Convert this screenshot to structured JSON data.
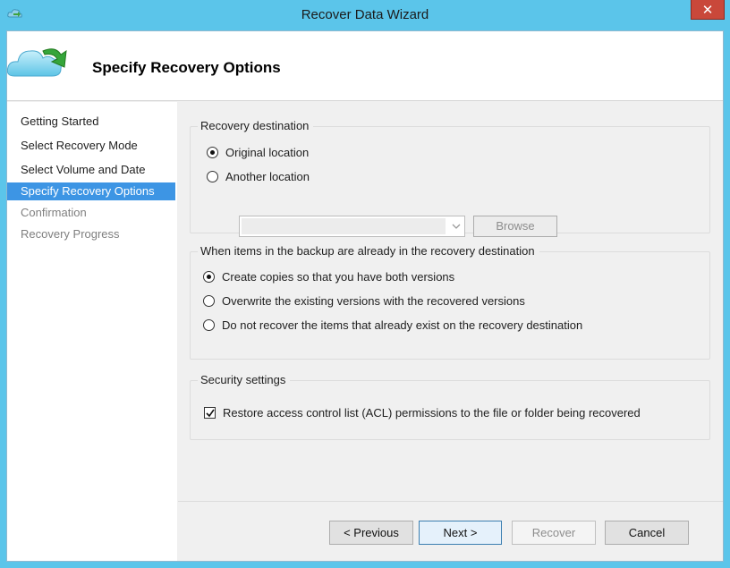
{
  "window": {
    "title": "Recover Data Wizard"
  },
  "header": {
    "title": "Specify Recovery Options"
  },
  "nav": {
    "items": [
      {
        "label": "Getting Started",
        "state": "done"
      },
      {
        "label": "Select Recovery Mode",
        "state": "done"
      },
      {
        "label": "Select Volume and Date",
        "state": "done"
      },
      {
        "label": "Specify Recovery Options",
        "state": "active"
      },
      {
        "label": "Confirmation",
        "state": "future"
      },
      {
        "label": "Recovery Progress",
        "state": "future"
      }
    ]
  },
  "recovery_destination": {
    "label": "Recovery destination",
    "options": [
      {
        "label": "Original location",
        "selected": true
      },
      {
        "label": "Another location",
        "selected": false
      }
    ],
    "location_value": "",
    "browse_label": "Browse"
  },
  "conflict": {
    "label": "When items in the backup are already in the recovery destination",
    "options": [
      {
        "label": "Create copies so that you have both versions",
        "selected": true
      },
      {
        "label": "Overwrite the existing versions with the recovered versions",
        "selected": false
      },
      {
        "label": "Do not recover the items that already exist on the recovery destination",
        "selected": false
      }
    ]
  },
  "security": {
    "label": "Security settings",
    "acl_label": "Restore access control list (ACL) permissions to the file or folder being recovered",
    "acl_checked": true
  },
  "footer": {
    "previous_label": "< Previous",
    "next_label": "Next >",
    "recover_label": "Recover",
    "cancel_label": "Cancel"
  },
  "colors": {
    "title_bar": "#5bc5ea",
    "nav_active": "#3d95e4",
    "close_button": "#c9483a"
  },
  "icons": {
    "app": "cloud-recovery-icon",
    "header": "cloud-arrow-icon",
    "close": "close-icon"
  }
}
